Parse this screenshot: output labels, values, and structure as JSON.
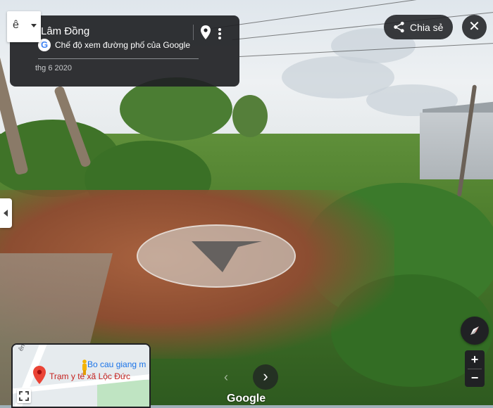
{
  "location": {
    "title": "Lâm Đồng",
    "subtitle": "Chế độ xem đường phố của Google",
    "date": "thg 6 2020"
  },
  "nav_control": {
    "glyph": "ê"
  },
  "top_right": {
    "share_label": "Chia sẻ",
    "close_symbol": "✕"
  },
  "minimap": {
    "place_primary": "Trạm y tế xã Lộc Đức",
    "place_secondary": "Bo cau giang m",
    "street_label": "ên Xã"
  },
  "navigation": {
    "prev_symbol": "‹",
    "next_symbol": "›"
  },
  "brand": "Google",
  "zoom": {
    "in": "+",
    "out": "−"
  },
  "icons": {
    "google_logo": "G",
    "pin": "location-pin-icon",
    "more": "more-vert-icon",
    "share": "share-icon",
    "compass": "compass-icon",
    "expand": "expand-icon"
  },
  "colors": {
    "panel": "#202124",
    "place_red": "#c5221f",
    "place_blue": "#1a73e8",
    "compass_needle": "#e53935"
  }
}
